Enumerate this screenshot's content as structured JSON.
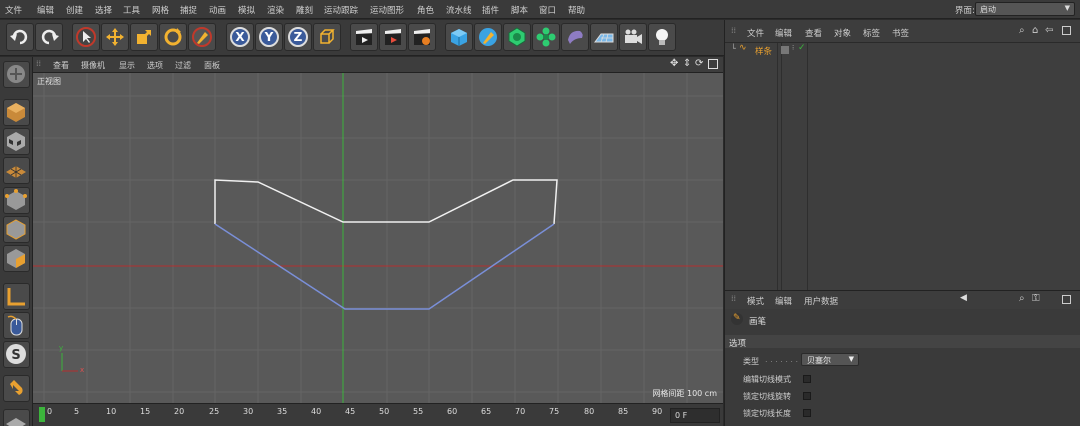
{
  "menu": [
    "文件",
    "编辑",
    "创建",
    "选择",
    "工具",
    "网格",
    "捕捉",
    "动画",
    "模拟",
    "渲染",
    "雕刻",
    "运动跟踪",
    "运动图形",
    "角色",
    "流水线",
    "插件",
    "脚本",
    "窗口",
    "帮助"
  ],
  "layout": {
    "label": "界面:",
    "value": "启动"
  },
  "viewport": {
    "menu": [
      "查看",
      "摄像机",
      "显示",
      "选项",
      "过滤",
      "面板"
    ],
    "name": "正视图",
    "grid_spacing_label": "网格间距",
    "grid_spacing_value": "100 cm",
    "axis_y": "y",
    "axis_x": "x"
  },
  "timeline": {
    "ticks": [
      "0",
      "5",
      "10",
      "15",
      "20",
      "25",
      "30",
      "35",
      "40",
      "45",
      "50",
      "55",
      "60",
      "65",
      "70",
      "75",
      "80",
      "85",
      "90"
    ],
    "frame": "0 F"
  },
  "object_manager": {
    "menu": [
      "文件",
      "编辑",
      "查看",
      "对象",
      "标签",
      "书签"
    ],
    "object_name": "样条"
  },
  "attribute_manager": {
    "menu": [
      "模式",
      "编辑",
      "用户数据"
    ],
    "tool_name": "画笔",
    "section": "选项",
    "type_label": "类型",
    "type_value": "贝塞尔",
    "options": [
      "编辑切线模式",
      "锁定切线旋转",
      "锁定切线长度"
    ]
  },
  "colors": {
    "accent_green": "#3cb43c",
    "axis_red": "#b43030",
    "spline_white": "#f0f0f0",
    "spline_blue": "#7a8fd8",
    "highlight_orange": "#e8a030"
  }
}
